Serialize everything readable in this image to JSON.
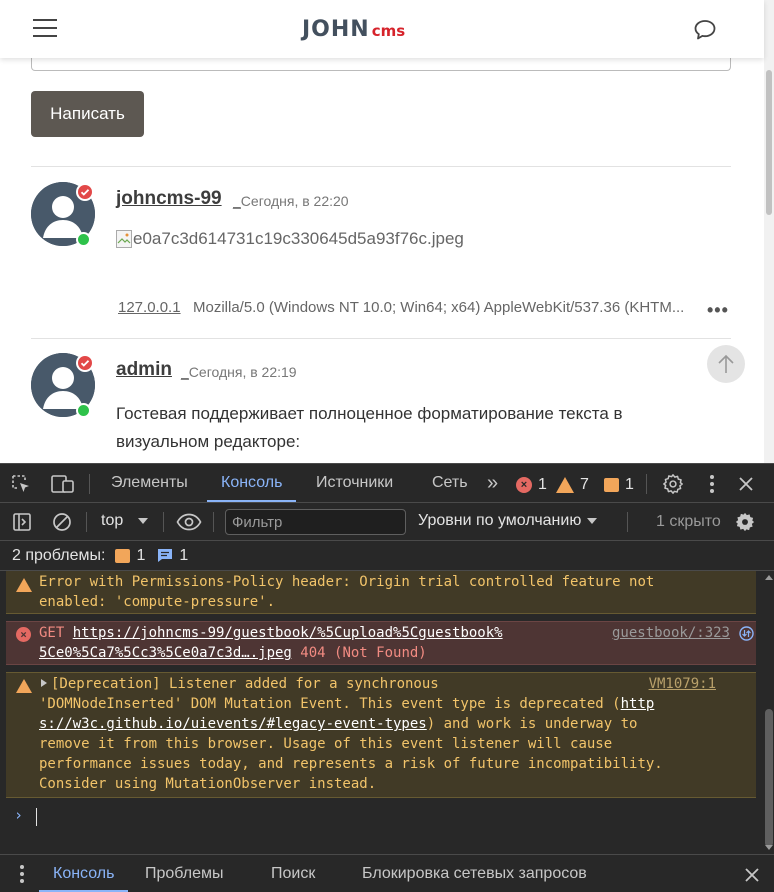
{
  "site": {
    "logo_main": "JOHN",
    "logo_sub": "cms",
    "write_button": "Написать",
    "posts": [
      {
        "username": "johncms-99",
        "time_prefix": "_",
        "time": "Сегодня, в 22:20",
        "image_alt": "e0a7c3d614731c19c330645d5a93f76c.jpeg",
        "ip": "127.0.0.1",
        "user_agent": "Mozilla/5.0 (Windows NT 10.0; Win64; x64) AppleWebKit/537.36 (KHTM...",
        "more": "•••"
      },
      {
        "username": "admin",
        "time_prefix": "_",
        "time": "Сегодня, в 22:19",
        "text": "Гостевая поддерживает полноценное форматирование текста в визуальном редакторе:"
      }
    ]
  },
  "devtools": {
    "tabs": [
      "Элементы",
      "Консоль",
      "Источники",
      "Сеть"
    ],
    "more_tabs": "»",
    "counts": {
      "errors": "1",
      "warnings": "7",
      "issues": "1"
    },
    "toolbar": {
      "context": "top",
      "filter_placeholder": "Фильтр",
      "levels": "Уровни по умолчанию",
      "hidden": "1 скрыто"
    },
    "issues_bar": {
      "label": "2 проблемы:",
      "warn_count": "1",
      "info_count": "1"
    },
    "messages": {
      "m1_line1": "Error with Permissions-Policy header: Origin trial controlled feature not",
      "m1_line2": "enabled: 'compute-pressure'.",
      "m2_method": "GET ",
      "m2_url1": "https://johncms-99/guestbook/%5Cupload%5Cguestbook%",
      "m2_src": "guestbook/:323",
      "m2_url2": "5Ce0%5Ca7%5Cc3%5Ce0a7c3d….jpeg",
      "m2_status": " 404 (Not Found)",
      "m3_line1": "[Deprecation] Listener added for a synchronous",
      "m3_src": "VM1079:1",
      "m3_line2a": "'DOMNodeInserted' DOM Mutation Event. This event type is deprecated (",
      "m3_link1": "http",
      "m3_link2": "s://w3c.github.io/uievents/#legacy-event-types",
      "m3_line3b": ") and work is underway to",
      "m3_line4": "remove it from this browser. Usage of this event listener will cause",
      "m3_line5": "performance issues today, and represents a risk of future incompatibility.",
      "m3_line6": "Consider using MutationObserver instead."
    },
    "prompt": "›",
    "drawer_tabs": [
      "Консоль",
      "Проблемы",
      "Поиск",
      "Блокировка сетевых запросов"
    ]
  }
}
